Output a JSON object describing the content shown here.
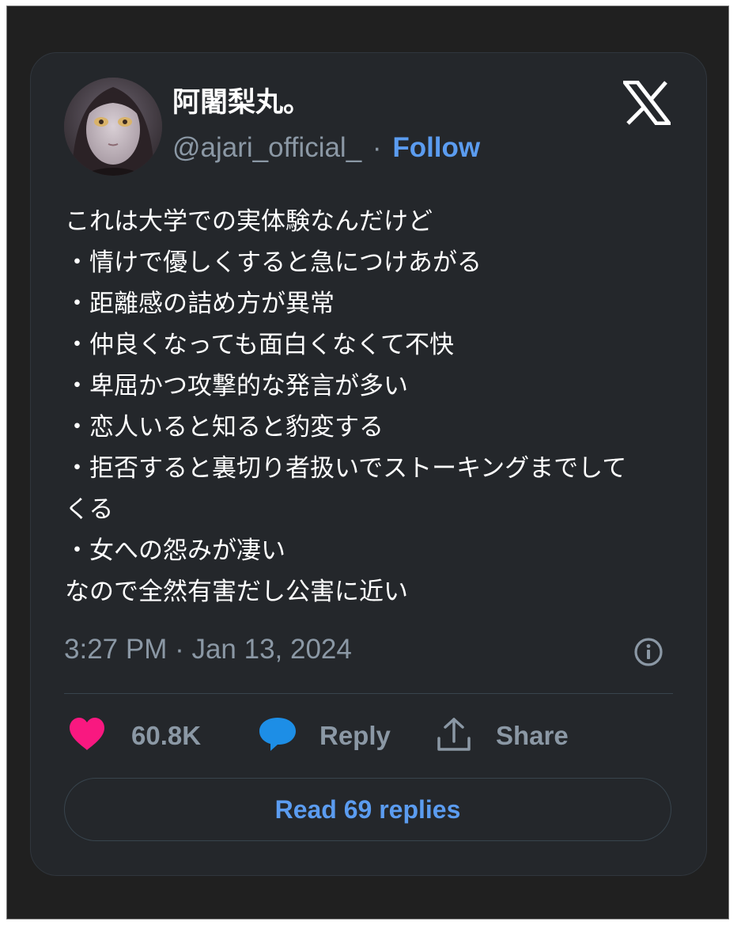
{
  "author": {
    "display_name": "阿闍梨丸。",
    "handle": "@ajari_official_",
    "separator": "·",
    "follow_label": "Follow"
  },
  "tweet": {
    "lines": [
      "これは大学での実体験なんだけど",
      "・情けで優しくすると急につけあがる",
      "・距離感の詰め方が異常",
      "・仲良くなっても面白くなくて不快",
      "・卑屈かつ攻撃的な発言が多い",
      "・恋人いると知ると豹変する",
      "・拒否すると裏切り者扱いでストーキングまでして",
      "くる",
      "・女への怨みが凄い",
      "なので全然有害だし公害に近い"
    ],
    "timestamp": "3:27 PM · Jan 13, 2024"
  },
  "actions": {
    "like_count": "60.8K",
    "reply_label": "Reply",
    "share_label": "Share",
    "read_replies_label": "Read 69 replies"
  },
  "icons": {
    "logo": "x-logo-icon",
    "info": "info-icon",
    "like": "heart-icon",
    "reply": "speech-bubble-icon",
    "share": "share-upload-icon"
  },
  "colors": {
    "card_background": "#24272b",
    "accent_blue": "#5b9cf0",
    "like_pink": "#f91880",
    "reply_blue": "#1d8ee6",
    "muted_text": "#8b98a5"
  }
}
